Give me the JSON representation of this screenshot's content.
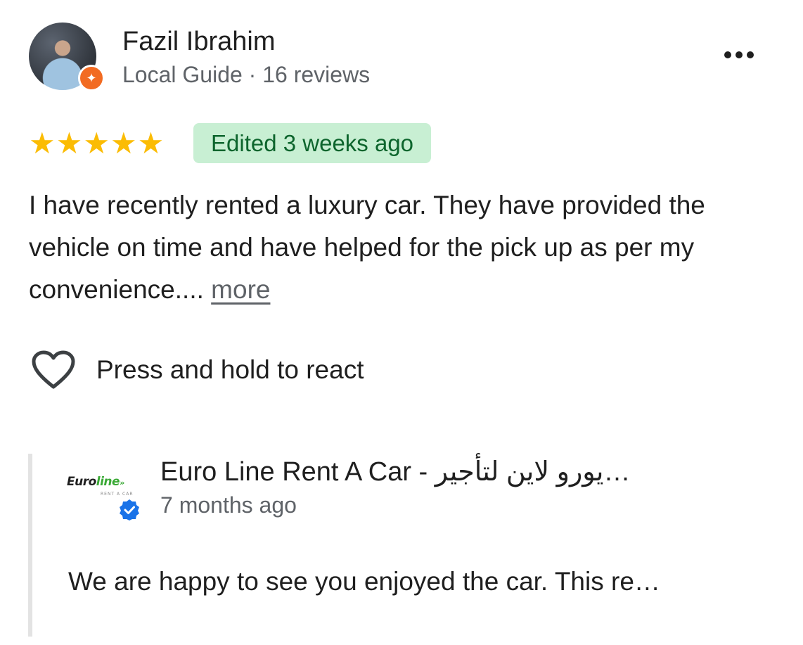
{
  "reviewer": {
    "name": "Fazil Ibrahim",
    "meta": "Local Guide · 16 reviews",
    "badge_icon": "local-guide-star-icon",
    "badge_color": "#f26b22"
  },
  "menu_icon": "more-horizontal-icon",
  "rating": {
    "stars": 5,
    "max": 5,
    "star_color": "#fbbc04"
  },
  "edited_label": "Edited 3 weeks ago",
  "review": {
    "text": "I have recently rented a luxury car. They have provided the vehicle on time and have helped for the pick up as per my convenience.... ",
    "more_label": "more"
  },
  "react": {
    "icon": "heart-outline-icon",
    "label": "Press and hold to react"
  },
  "owner_response": {
    "logo_text_dark": "Euro",
    "logo_text_green": "line",
    "logo_sub": "RENT A CAR",
    "verified_icon": "verified-check-icon",
    "name": "Euro Line Rent A Car - يورو لاين لتأجير…",
    "time": "7 months ago",
    "text": "We are happy to see you enjoyed the car. This re…"
  }
}
